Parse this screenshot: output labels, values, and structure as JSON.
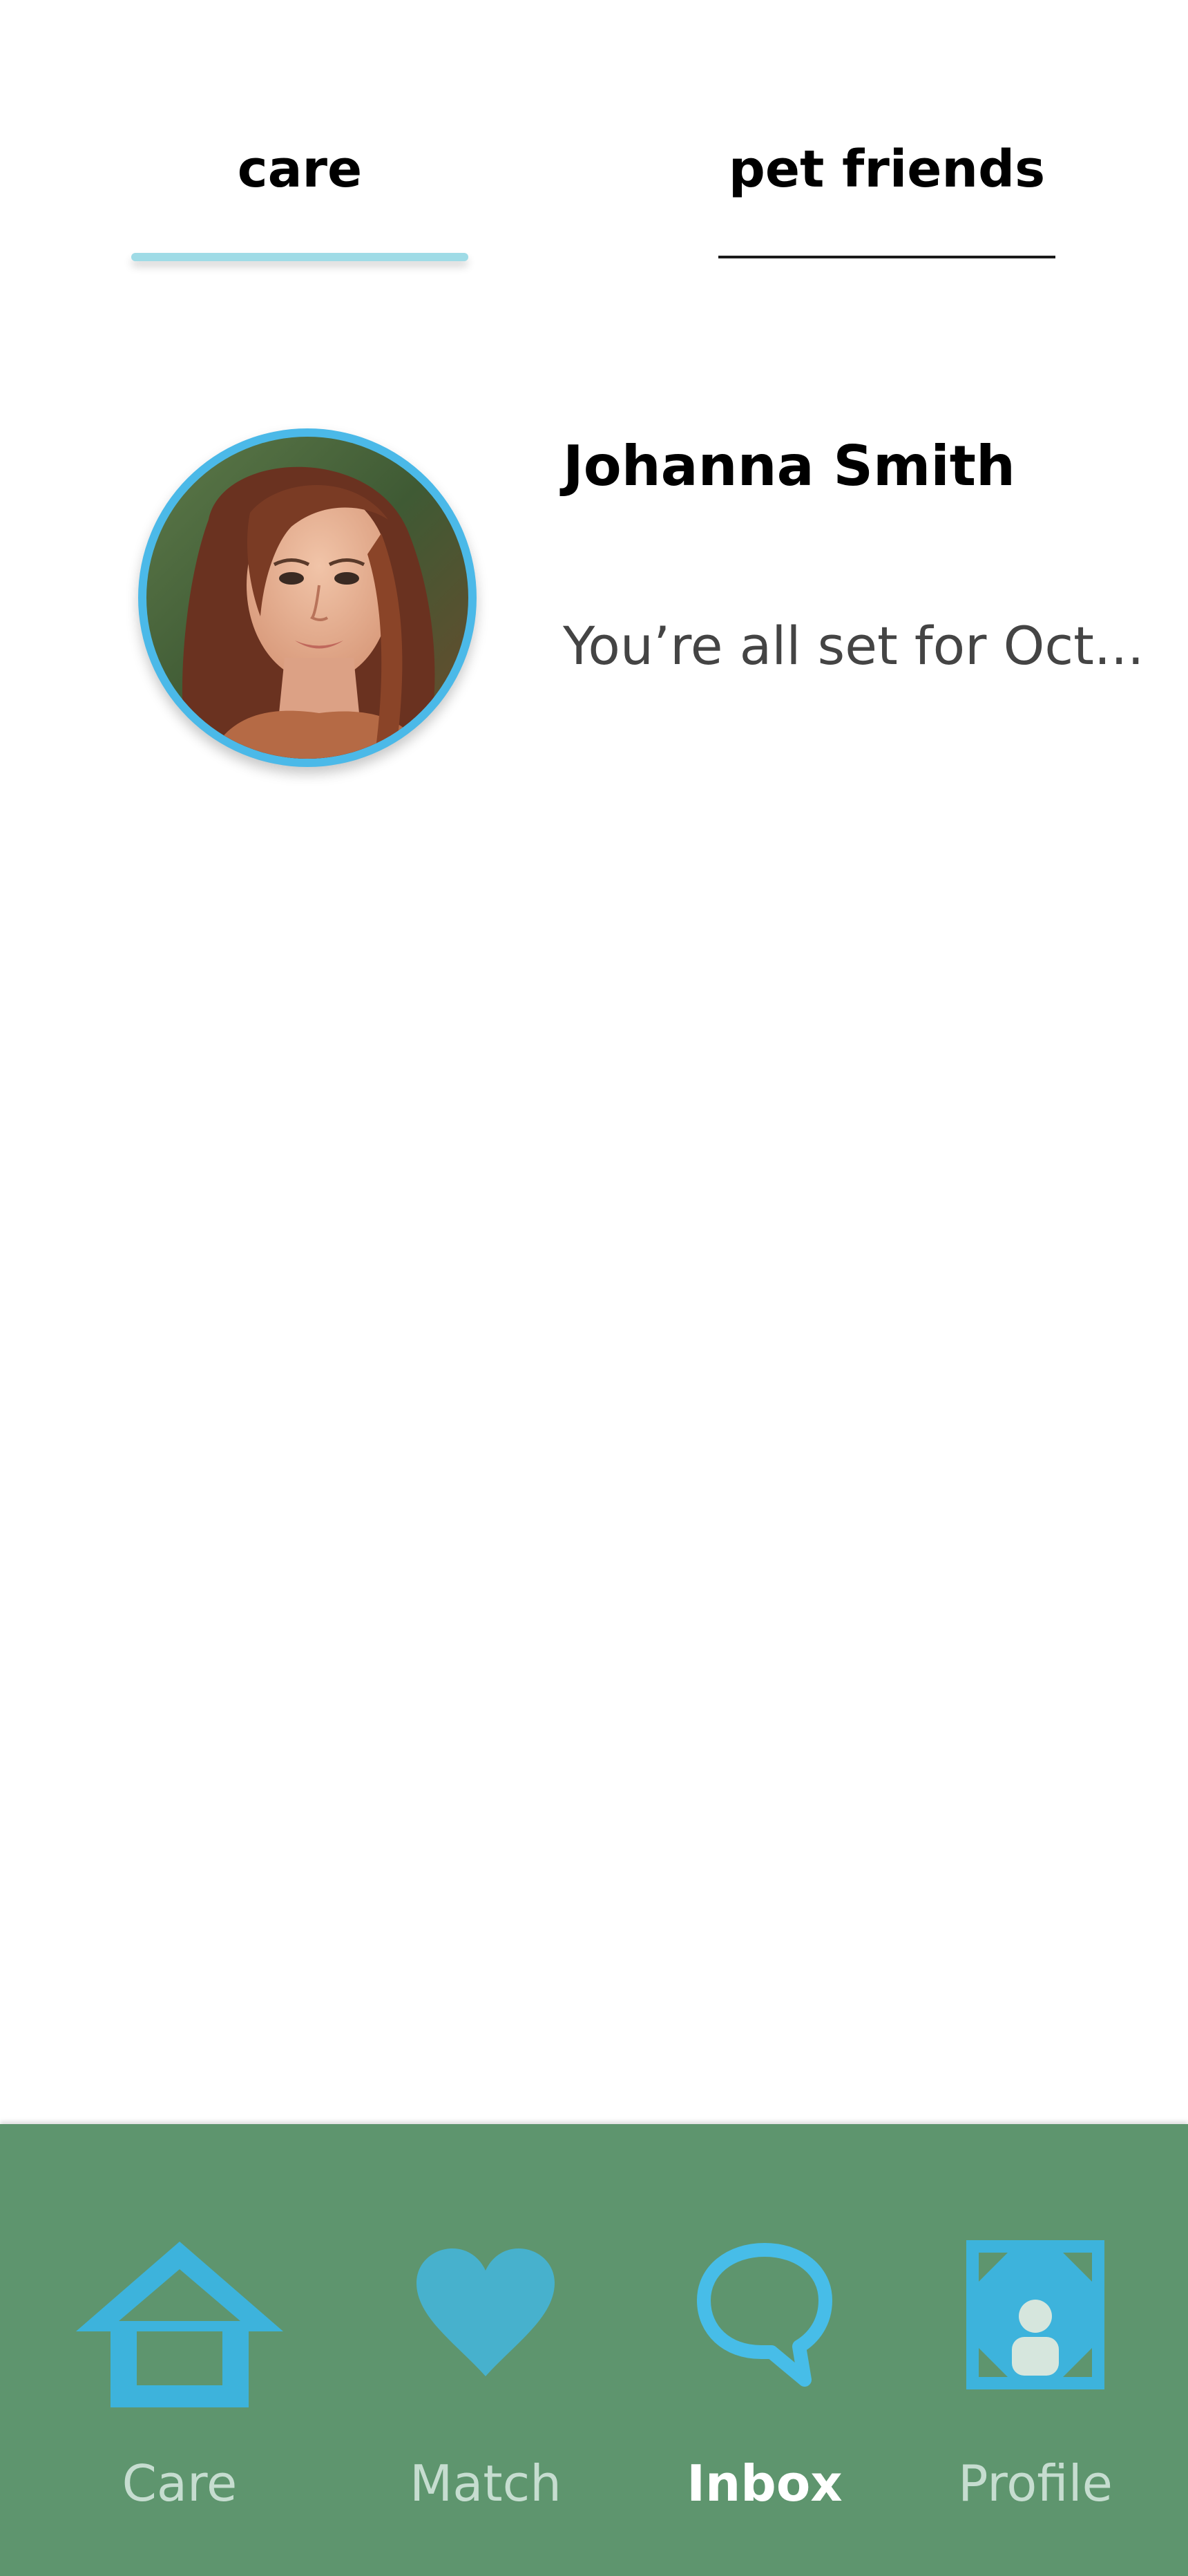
{
  "tabs": [
    {
      "label": "care",
      "active": true
    },
    {
      "label": "pet friends",
      "active": false
    }
  ],
  "conversations": [
    {
      "name": "Johanna Smith",
      "preview": "You’re all set for Oct..."
    }
  ],
  "bottom_nav": {
    "items": [
      {
        "label": "Care",
        "icon": "house-icon",
        "active": false
      },
      {
        "label": "Match",
        "icon": "heart-icon",
        "active": false
      },
      {
        "label": "Inbox",
        "icon": "speech-bubble-icon",
        "active": true
      },
      {
        "label": "Profile",
        "icon": "profile-card-icon",
        "active": false
      }
    ]
  },
  "colors": {
    "accent_blue": "#4bb9e8",
    "tab_underline": "#9fdbe6",
    "nav_background": "#5e956e",
    "nav_label": "#c6ddd0",
    "nav_label_active": "#ffffff"
  }
}
